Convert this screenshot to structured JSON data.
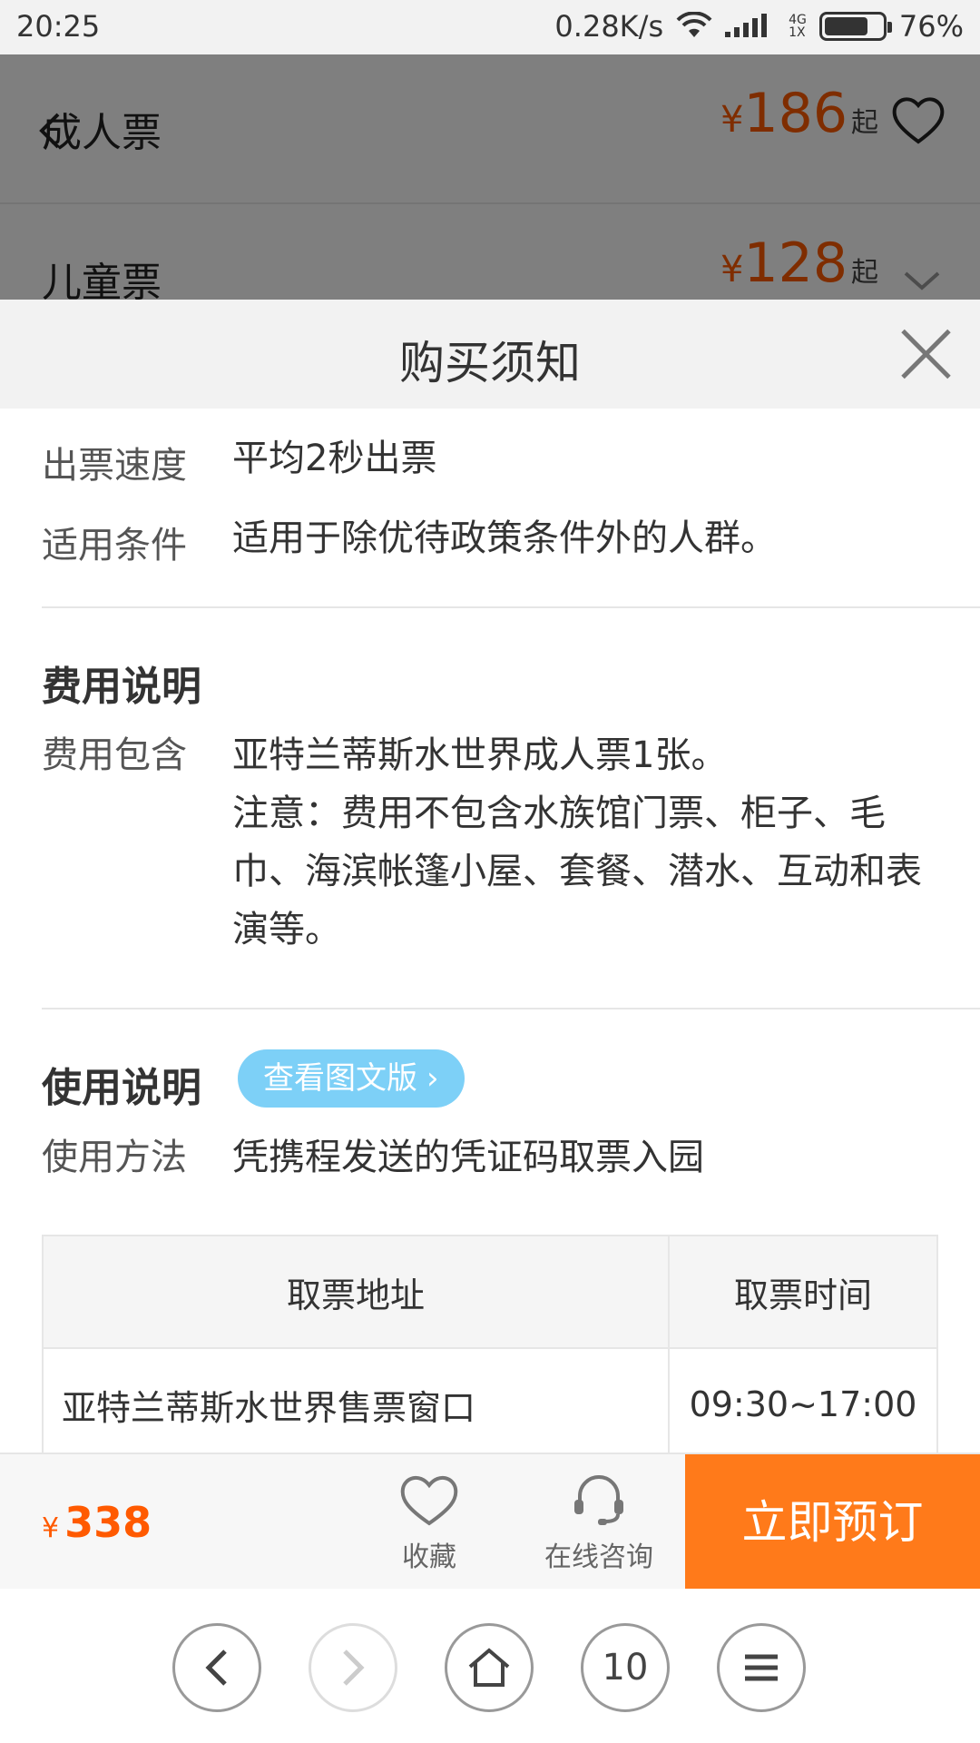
{
  "status_bar": {
    "time": "20:25",
    "speed": "0.28K/s",
    "network": "4G",
    "network_sub": "1X",
    "battery": "76%"
  },
  "background_list": {
    "items": [
      {
        "name": "成人票",
        "currency": "¥",
        "price": "186",
        "suffix": "起"
      },
      {
        "name": "儿童票",
        "currency": "¥",
        "price": "128",
        "suffix": "起"
      }
    ]
  },
  "modal": {
    "title": "购买须知",
    "ticket_speed": {
      "label": "出票速度",
      "value": "平均2秒出票"
    },
    "applicable": {
      "label": "适用条件",
      "value": "适用于除优待政策条件外的人群。"
    },
    "fee_section_title": "费用说明",
    "fee_includes": {
      "label": "费用包含",
      "line1": "亚特兰蒂斯水世界成人票1张。",
      "line2": "注意：费用不包含水族馆门票、柜子、毛巾、海滨帐篷小屋、套餐、潜水、互动和表演等。"
    },
    "usage_section_title": "使用说明",
    "view_graphic_button": "查看图文版",
    "usage_method": {
      "label": "使用方法",
      "value": "凭携程发送的凭证码取票入园"
    },
    "table": {
      "headers": [
        "取票地址",
        "取票时间"
      ],
      "rows": [
        [
          "亚特兰蒂斯水世界售票窗口",
          "09:30~17:00"
        ]
      ]
    }
  },
  "action_bar": {
    "currency": "¥",
    "total_price": "338",
    "favorite_label": "收藏",
    "consult_label": "在线咨询",
    "book_label": "立即预订"
  },
  "browser_nav": {
    "tab_count": "10"
  }
}
